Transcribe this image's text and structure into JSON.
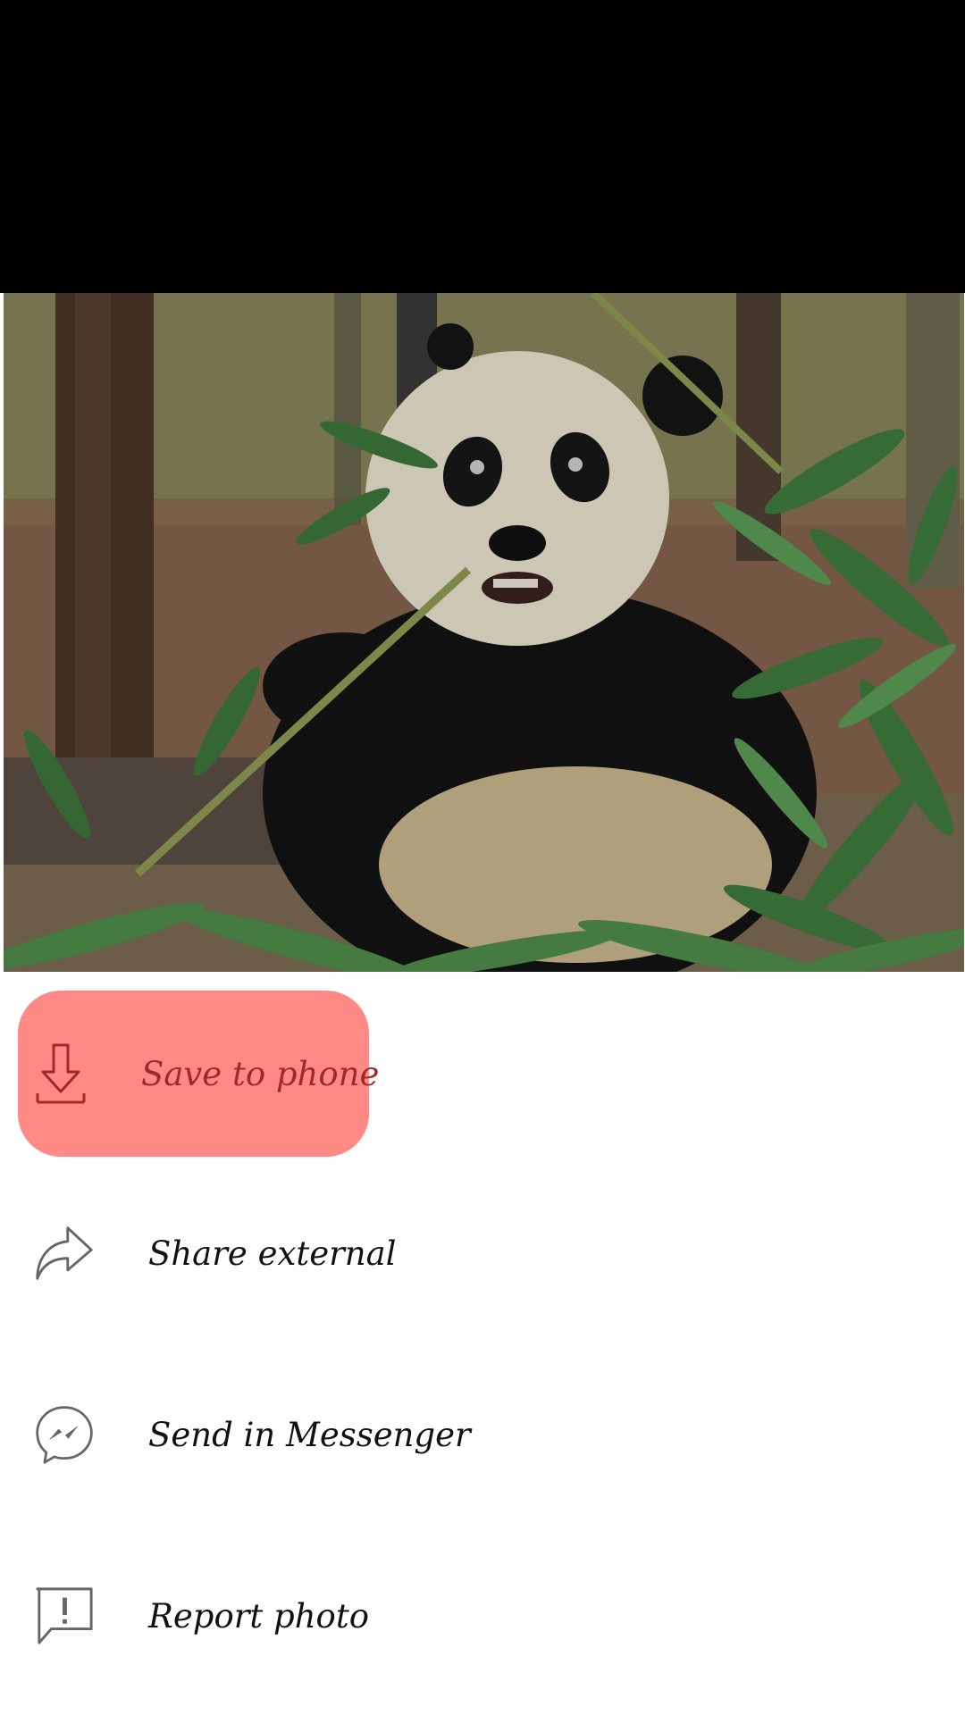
{
  "menu": {
    "items": [
      {
        "label": "Save to phone",
        "icon": "download-icon",
        "highlighted": true
      },
      {
        "label": "Share external",
        "icon": "share-arrow-icon",
        "highlighted": false
      },
      {
        "label": "Send in Messenger",
        "icon": "messenger-icon",
        "highlighted": false
      },
      {
        "label": "Report photo",
        "icon": "report-flag-icon",
        "highlighted": false
      }
    ]
  },
  "colors": {
    "highlight_bg": "#ff8a85",
    "highlight_text": "#a02a2a",
    "icon_gray": "#666666"
  }
}
